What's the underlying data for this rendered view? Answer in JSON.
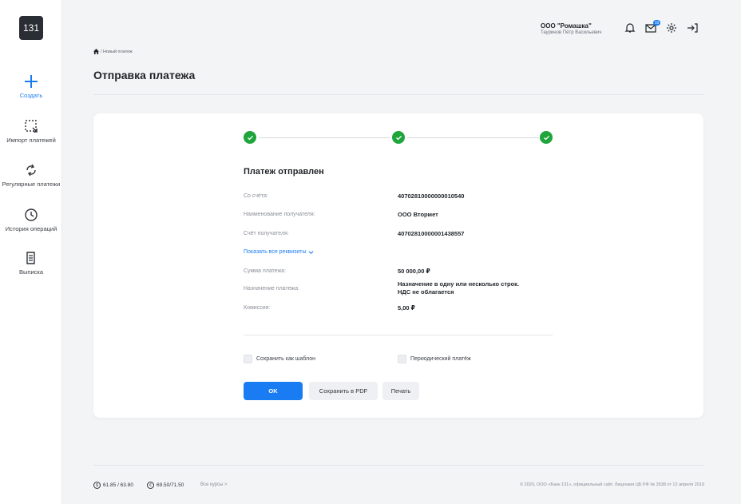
{
  "logo": "131",
  "sidebar": {
    "items": [
      {
        "label": "Создать",
        "icon": "plus-icon"
      },
      {
        "label": "Импорт платежей",
        "icon": "import-icon"
      },
      {
        "label": "Регулярные платежи",
        "icon": "refresh-icon"
      },
      {
        "label": "История операций",
        "icon": "clock-icon"
      },
      {
        "label": "Выписка",
        "icon": "document-icon"
      }
    ]
  },
  "header": {
    "company": "ООО \"Ромашка\"",
    "user": "Тауринов Пётр Васильевич",
    "mail_badge": "10"
  },
  "breadcrumb": "/ Новый платеж",
  "page_title": "Отправка платежа",
  "card": {
    "heading": "Платеж отправлен",
    "rows": [
      {
        "label": "Со счёта:",
        "value": "40702810000000010540"
      },
      {
        "label": "Наименование получателя:",
        "value": "ООО Втормет"
      },
      {
        "label": "Счёт получателя:",
        "value": "40702810000001438557"
      },
      {
        "label": "Сумма платежа:",
        "value": "50 000,00 ₽"
      },
      {
        "label": "Назначение платежа:",
        "value": "Назначение в одну или несколько строк.",
        "value2": "НДС не облагается"
      },
      {
        "label": "Комиссия:",
        "value": "5,00 ₽"
      }
    ],
    "show_all": "Показать все реквизиты",
    "save_template": "Сохранить как шаблон",
    "periodic": "Периодический платёж",
    "buttons": {
      "ok": "OK",
      "pdf": "Сохранить в PDF",
      "print": "Печать"
    }
  },
  "footer": {
    "usd_symbol": "$",
    "usd": "61.85 / 63.80",
    "eur_symbol": "€",
    "eur": "69.50/71.50",
    "all_rates": "Все курсы >",
    "copyright": "© 2020, ООО «Банк 131», официальный сайт. Лицензия ЦБ РФ № 3538 от 12 апреля 2019"
  },
  "colors": {
    "accent": "#1a7cf2",
    "success": "#1fa53b"
  }
}
